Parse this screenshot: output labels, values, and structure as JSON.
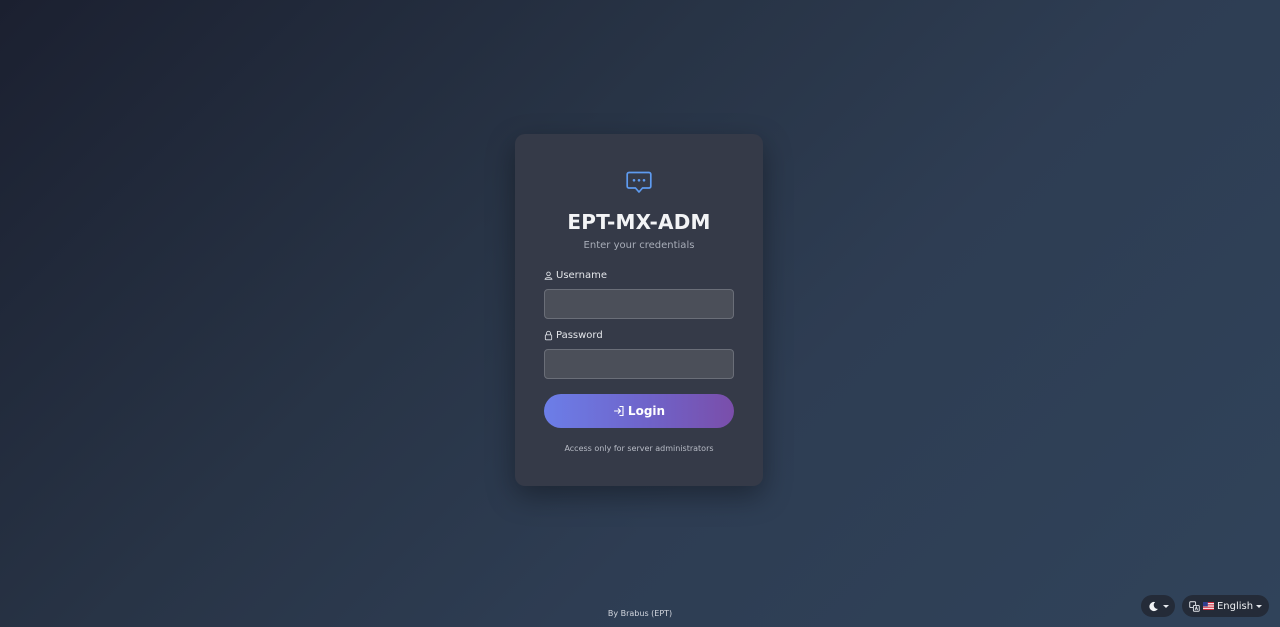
{
  "login_card": {
    "logo_icon": "chat-bubble-dots-icon",
    "title": "EPT-MX-ADM",
    "subtitle": "Enter your credentials",
    "username": {
      "icon": "user-icon",
      "label": "Username",
      "value": "",
      "placeholder": ""
    },
    "password": {
      "icon": "lock-icon",
      "label": "Password",
      "value": "",
      "placeholder": ""
    },
    "login_button": {
      "icon": "login-arrow-icon",
      "label": "Login"
    },
    "note": "Access only for server administrators"
  },
  "footer": {
    "text": "By Brabus (EPT)"
  },
  "controls": {
    "theme_toggle_icon": "moon-icon",
    "language": {
      "icon": "translate-icon",
      "flag": "us-flag-icon",
      "selected": "English"
    }
  },
  "colors": {
    "accent_start": "#6c7ee8",
    "accent_end": "#7a4eaa",
    "icon_blue": "#5e9bf0"
  }
}
